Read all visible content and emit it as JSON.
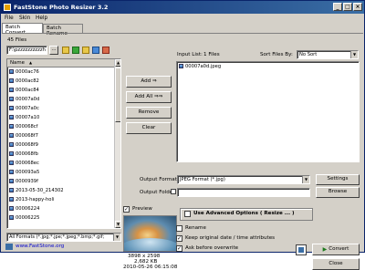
{
  "window": {
    "title": "FastStone Photo Resizer 3.2"
  },
  "title_buttons": {
    "minimize": "_",
    "maximize": "□",
    "close": "×"
  },
  "menu": [
    "File",
    "Skin",
    "Help"
  ],
  "tabs": [
    "Batch Convert",
    "Batch Rename"
  ],
  "browser": {
    "file_count": "45 Files",
    "path": "F:\\pzzzzzzzzzzh",
    "path_button": "...",
    "column_name": "Name",
    "files": [
      "0000ac76",
      "0000ac82",
      "0000ac84",
      "00007a0d",
      "00007a0c",
      "00007a10",
      "000068cf",
      "000068f7",
      "000068f9",
      "000068fb",
      "000068ec",
      "000093a5",
      "0000939f",
      "2013-05-30_214302",
      "2013-happy-holi",
      "00006224",
      "00006225"
    ],
    "filter_value": "All Formats (*.jpg;*.jpe;*.jpeg;*.bmp;*.gif;"
  },
  "actions": {
    "add": "Add ⇒",
    "add_all": "Add All ⇒⇒",
    "remove": "Remove",
    "clear": "Clear"
  },
  "input_list": {
    "label": "Input List:",
    "count": "1 Files",
    "sort_label": "Sort Files By:",
    "sort_value": "No Sort",
    "files": [
      "00007a0d.jpeg"
    ]
  },
  "output": {
    "format_label": "Output Format:",
    "format_value": "JPEG Format (*.jpg)",
    "settings_button": "Settings",
    "folder_label": "Output Folder:",
    "folder_value": "",
    "browse_button": "Browse"
  },
  "preview": {
    "checkbox_label": "Preview",
    "checked": true,
    "dimensions": "3898 x 2598",
    "filesize": "2,682 KB",
    "date": "2010-05-26 06:15:08"
  },
  "options": {
    "advanced_label": "Use Advanced Options ( Resize ... )",
    "advanced_checked": false,
    "rename_label": "Rename",
    "rename_checked": false,
    "keep_date_label": "Keep original date / time attributes",
    "keep_date_checked": true,
    "ask_label": "Ask before overwrite",
    "ask_checked": true
  },
  "buttons": {
    "convert": "Convert",
    "close": "Close"
  },
  "footer": {
    "website": "www.FastStone.org"
  },
  "colors": {
    "title_start": "#0a246a",
    "title_end": "#3a6ea5",
    "face": "#d4d0c8",
    "link": "#0000cc"
  }
}
